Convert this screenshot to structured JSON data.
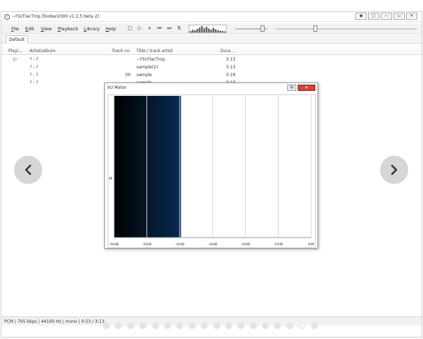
{
  "window": {
    "title": "~FlicFlacTmp  [foobar2000 v1.2.5 beta 2]",
    "icon": "foobar-app-icon",
    "controls": [
      "◉",
      "▢",
      "—",
      "▭",
      "✕"
    ]
  },
  "menu": {
    "items": [
      "File",
      "Edit",
      "View",
      "Playback",
      "Library",
      "Help"
    ]
  },
  "toolbar": {
    "icons": [
      {
        "name": "stop-icon",
        "glyph": "□"
      },
      {
        "name": "play-icon",
        "glyph": "▷"
      },
      {
        "name": "pause-icon",
        "glyph": "⏸"
      },
      {
        "name": "previous-icon",
        "glyph": "⏮"
      },
      {
        "name": "next-icon",
        "glyph": "⏭"
      },
      {
        "name": "random-icon",
        "glyph": "⇅"
      }
    ],
    "spectrum_levels": [
      0.2,
      0.35,
      0.3,
      0.5,
      0.7,
      0.9,
      0.6,
      0.8,
      0.55,
      0.4,
      0.65,
      0.45,
      0.3,
      0.25,
      0.2,
      0.15
    ],
    "volume_level": 0.85,
    "seek_position": 0.28
  },
  "tabs": {
    "active": "Default"
  },
  "playlist": {
    "columns": [
      "Playi...",
      "Artist/album",
      "Track no",
      "Title / track artist",
      "Dura..."
    ],
    "rows": [
      {
        "playing": "▷",
        "artist": "? - ?",
        "track": "",
        "title": "~FlicFlacTmp",
        "duration": "3:13"
      },
      {
        "playing": "",
        "artist": "? - ?",
        "track": "",
        "title": "sample(2)",
        "duration": "3:13"
      },
      {
        "playing": "",
        "artist": "? - ?",
        "track": "00",
        "title": "sample",
        "duration": "3:19"
      },
      {
        "playing": "",
        "artist": "? - ?",
        "track": "",
        "title": "sample",
        "duration": "3:13"
      }
    ]
  },
  "vu_meter": {
    "title": "VU Meter",
    "side_label": "M",
    "close_glyph": "✕",
    "min_glyph": "▤",
    "level_fraction": 0.34,
    "bar_color_dark": "#000000",
    "bar_color_light": "#0a2b52",
    "scale": [
      "-60dB",
      "-50dB",
      "-40dB",
      "-30dB",
      "-20dB",
      "-10dB",
      "0dB"
    ]
  },
  "status": {
    "text": "PCM | 705 kbps | 44100 Hz | mono | 0:53 / 3:13"
  },
  "carousel": {
    "prev_icon": "chevron-left-icon",
    "next_icon": "chevron-right-icon",
    "dot_count": 18,
    "active_dot": 16
  }
}
